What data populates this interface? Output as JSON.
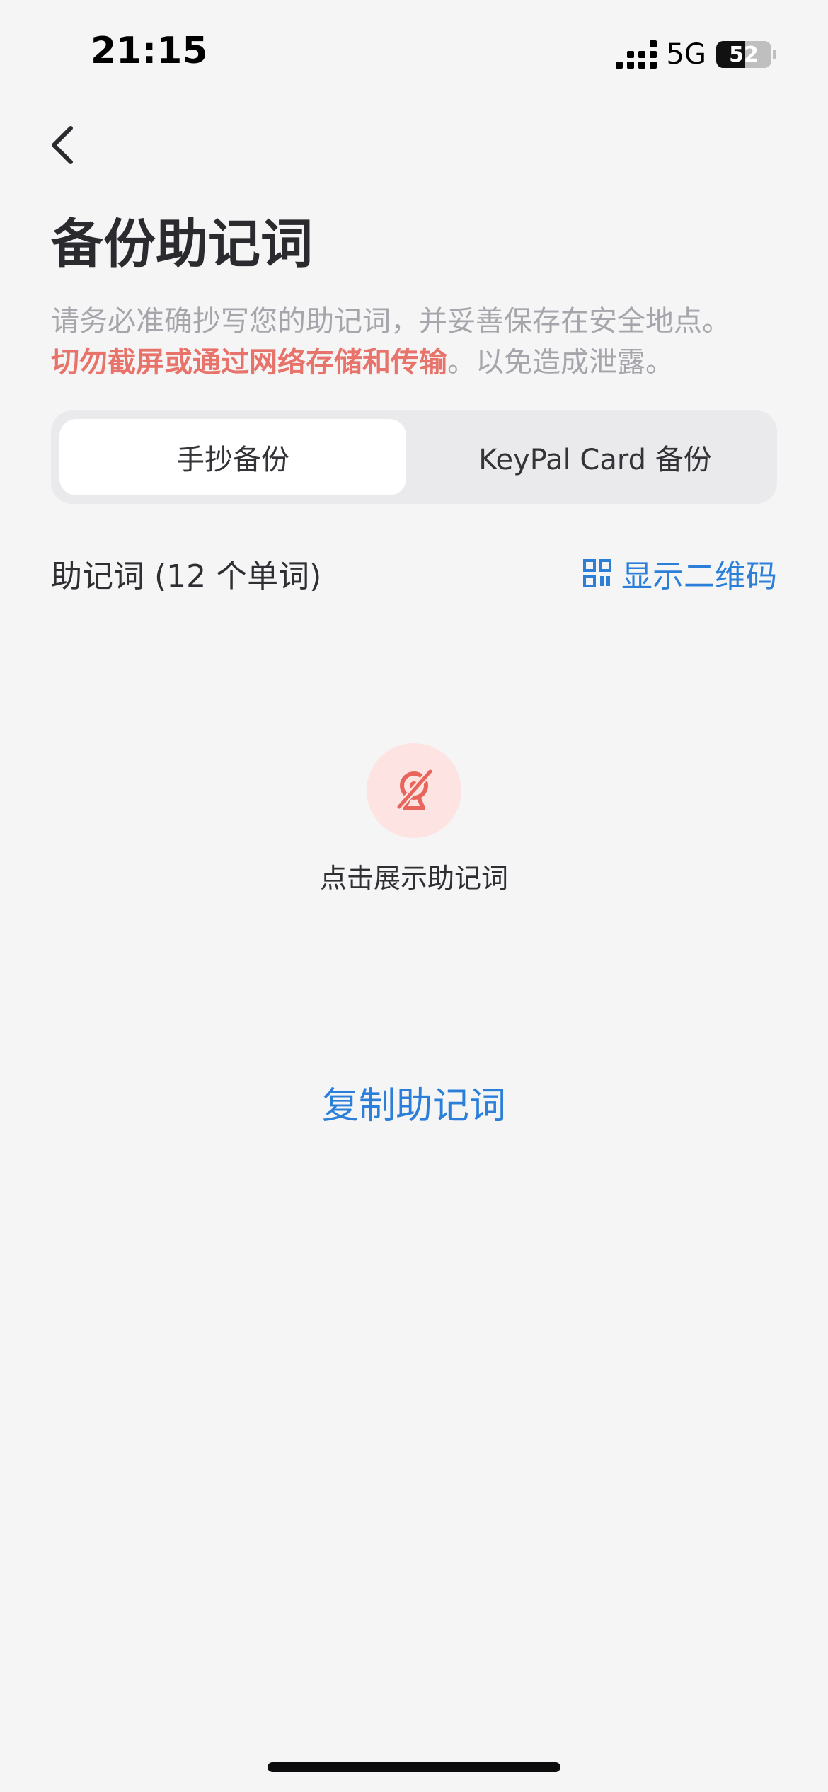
{
  "status_bar": {
    "time": "21:15",
    "network": "5G",
    "battery": "52",
    "battery_level": 0.52
  },
  "header": {
    "back_icon": "chevron-left-icon",
    "title": "备份助记词",
    "subtitle_normal": "请务必准确抄写您的助记词，并妥善保存在安全地点。",
    "subtitle_warning": "切勿截屏或通过网络存储和传输",
    "subtitle_tail": "。以免造成泄露。"
  },
  "tabs": [
    {
      "label": "手抄备份",
      "active": true
    },
    {
      "label": "KeyPal Card 备份",
      "active": false
    }
  ],
  "mnemonic": {
    "label": "助记词 (12 个单词)",
    "qr_label": "显示二维码",
    "qr_icon": "qr-code-icon",
    "reveal_icon": "eye-off-icon",
    "reveal_label": "点击展示助记词",
    "copy_label": "复制助记词"
  },
  "colors": {
    "accent": "#2b7fd9",
    "warning": "#e8736a",
    "background": "#f5f5f6"
  }
}
